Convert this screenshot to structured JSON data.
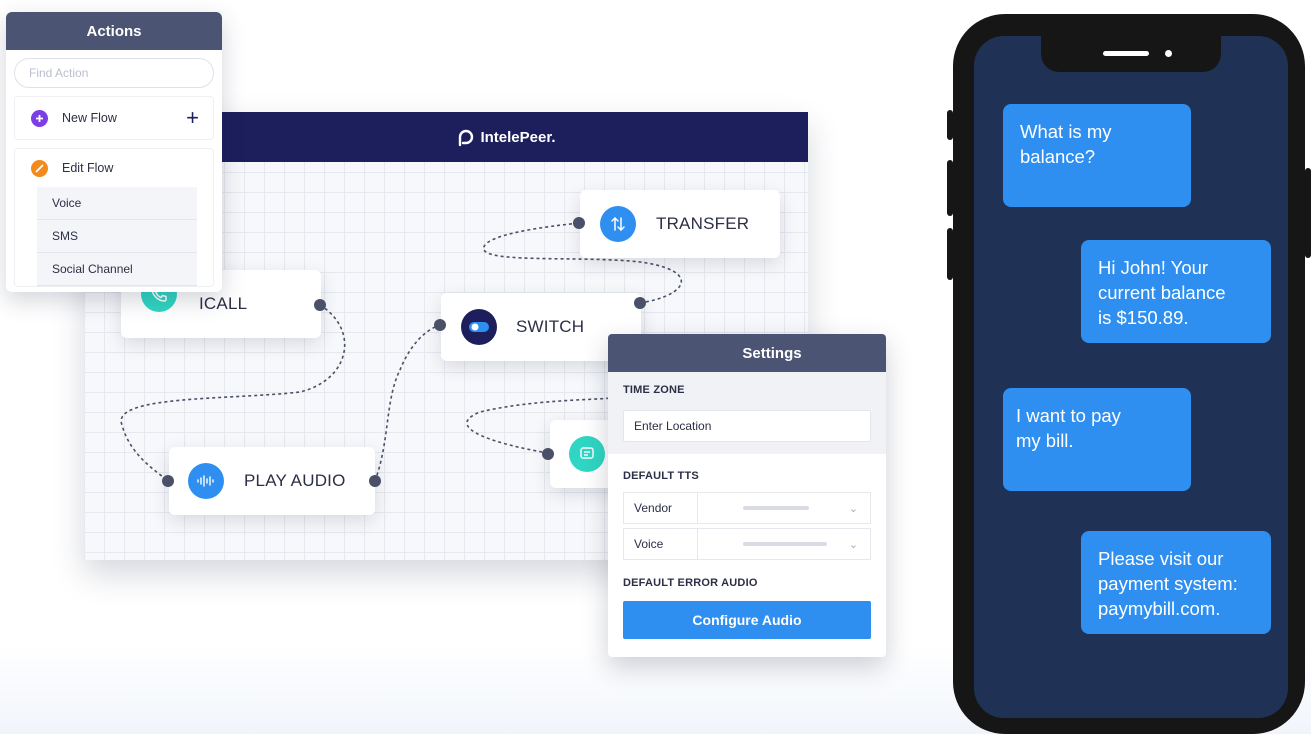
{
  "canvas": {
    "brand": "IntelePeer.",
    "nodes": {
      "icall": "ICALL",
      "play_audio": "PLAY AUDIO",
      "switch": "SWITCH",
      "transfer": "TRANSFER"
    }
  },
  "actions": {
    "title": "Actions",
    "search_placeholder": "Find Action",
    "new_flow": "New Flow",
    "new_flow_add": "+",
    "edit_flow": "Edit Flow",
    "items": [
      "Voice",
      "SMS",
      "Social Channel"
    ]
  },
  "settings": {
    "title": "Settings",
    "time_zone_label": "TIME ZONE",
    "location_placeholder": "Enter Location",
    "default_tts_label": "DEFAULT TTS",
    "vendor_label": "Vendor",
    "voice_label": "Voice",
    "default_error_audio_label": "DEFAULT ERROR AUDIO",
    "configure_button": "Configure Audio"
  },
  "chat": {
    "messages": [
      "What is my\nbalance?",
      "Hi John! Your\ncurrent balance\nis $150.89.",
      "I want to pay\nmy bill.",
      "Please visit our\npayment system:\npaymybill.com."
    ]
  },
  "colors": {
    "header_navy": "#1c1f5c",
    "panel_header": "#4b5573",
    "accent_blue": "#2e8ff0",
    "teal": "#2fd6c3",
    "purple": "#7b3fe4",
    "orange": "#f28a1c",
    "phone_screen": "#1f3255"
  },
  "icons": {
    "brand": "intelepeer-logo",
    "icall": "phone-icon",
    "play_audio": "audio-wave-icon",
    "switch": "toggle-icon",
    "transfer": "transfer-arrows-icon",
    "message": "message-icon",
    "new_flow": "plus-circle-icon",
    "edit_flow": "pencil-icon"
  }
}
